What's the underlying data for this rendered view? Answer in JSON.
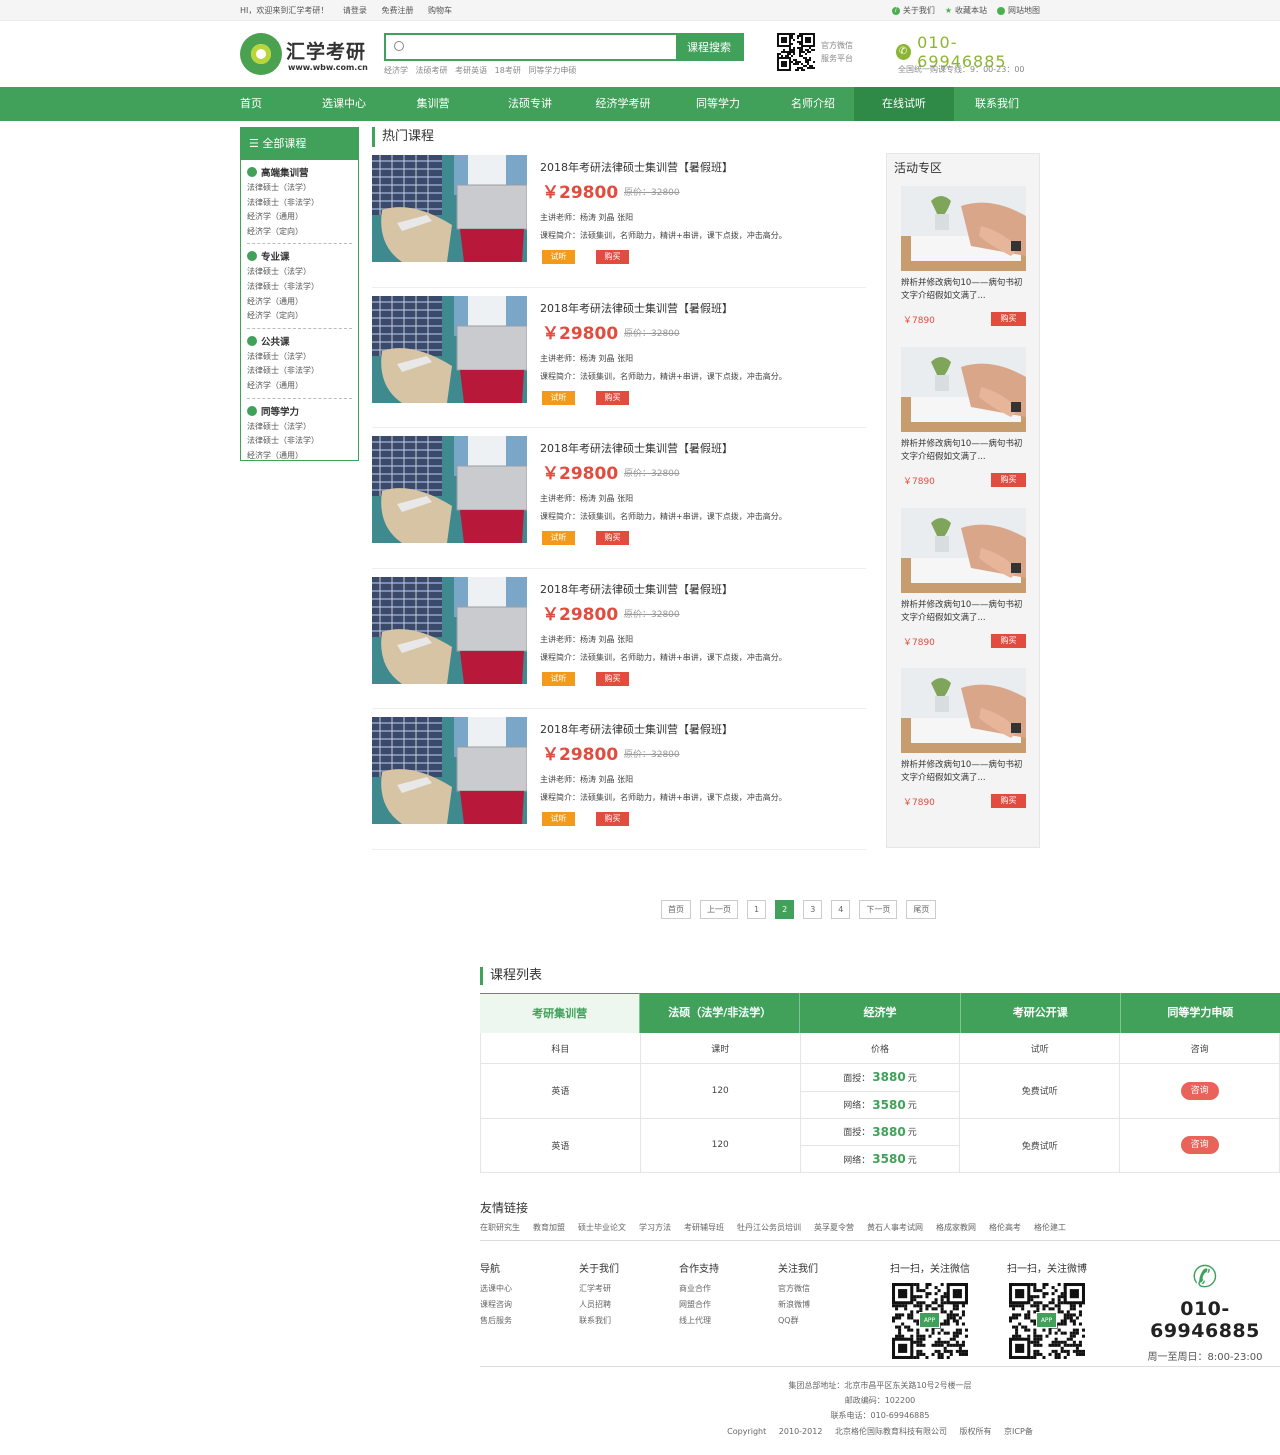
{
  "topbar": {
    "welcome": "HI，欢迎来到汇学考研！",
    "login": "请登录",
    "register": "免费注册",
    "cart": "购物车",
    "about": "关于我们",
    "favorite": "收藏本站",
    "sitemap": "网站地图"
  },
  "header": {
    "logo_title": "汇学考研",
    "logo_url": "www.wbw.com.cn",
    "search_placeholder": "",
    "search_button": "课程搜索",
    "hot_keywords": [
      "经济学",
      "法硕考研",
      "考研英语",
      "18考研",
      "同等学力申硕"
    ],
    "wechat_line1": "官方微信",
    "wechat_line2": "服务平台",
    "phone": "010-69946885",
    "phone_note": "全国统一购课专线：9：00-23：00"
  },
  "nav": {
    "items": [
      "首页",
      "选课中心",
      "集训营",
      "法硕专讲",
      "经济学考研",
      "同等学力",
      "名师介绍",
      "在线试听",
      "联系我们"
    ],
    "active_index": 7
  },
  "sidebar": {
    "title": "全部课程",
    "groups": [
      {
        "title": "高端集训营",
        "items": [
          "法律硕士（法学）",
          "法律硕士（非法学）",
          "经济学（通用）",
          "经济学（定向）"
        ]
      },
      {
        "title": "专业课",
        "items": [
          "法律硕士（法学）",
          "法律硕士（非法学）",
          "经济学（通用）",
          "经济学（定向）"
        ]
      },
      {
        "title": "公共课",
        "items": [
          "法律硕士（法学）",
          "法律硕士（非法学）",
          "经济学（通用）"
        ]
      },
      {
        "title": "同等学力",
        "items": [
          "法律硕士（法学）",
          "法律硕士（非法学）",
          "经济学（通用）"
        ]
      }
    ]
  },
  "hot": {
    "title": "热门课程",
    "courses": [
      {
        "name": "2018年考研法律硕士集训营【暑假班】",
        "price": "￥29800",
        "old_price": "原价：32800",
        "teacher": "主讲老师：杨涛  刘晶  张阳",
        "intro": "课程简介：法硕集训，名师助力，精讲+串讲，课下点拨，冲击高分。",
        "trial": "试听",
        "buy": "购买"
      },
      {
        "name": "2018年考研法律硕士集训营【暑假班】",
        "price": "￥29800",
        "old_price": "原价：32800",
        "teacher": "主讲老师：杨涛  刘晶  张阳",
        "intro": "课程简介：法硕集训，名师助力，精讲+串讲，课下点拨，冲击高分。",
        "trial": "试听",
        "buy": "购买"
      },
      {
        "name": "2018年考研法律硕士集训营【暑假班】",
        "price": "￥29800",
        "old_price": "原价：32800",
        "teacher": "主讲老师：杨涛  刘晶  张阳",
        "intro": "课程简介：法硕集训，名师助力，精讲+串讲，课下点拨，冲击高分。",
        "trial": "试听",
        "buy": "购买"
      },
      {
        "name": "2018年考研法律硕士集训营【暑假班】",
        "price": "￥29800",
        "old_price": "原价：32800",
        "teacher": "主讲老师：杨涛  刘晶  张阳",
        "intro": "课程简介：法硕集训，名师助力，精讲+串讲，课下点拨，冲击高分。",
        "trial": "试听",
        "buy": "购买"
      },
      {
        "name": "2018年考研法律硕士集训营【暑假班】",
        "price": "￥29800",
        "old_price": "原价：32800",
        "teacher": "主讲老师：杨涛  刘晶  张阳",
        "intro": "课程简介：法硕集训，名师助力，精讲+串讲，课下点拨，冲击高分。",
        "trial": "试听",
        "buy": "购买"
      }
    ]
  },
  "activity": {
    "title": "活动专区",
    "items": [
      {
        "text": "辨析并修改病句10——病句书初文字介绍假如文满了...",
        "price": "￥7890",
        "buy": "购买"
      },
      {
        "text": "辨析并修改病句10——病句书初文字介绍假如文满了...",
        "price": "￥7890",
        "buy": "购买"
      },
      {
        "text": "辨析并修改病句10——病句书初文字介绍假如文满了...",
        "price": "￥7890",
        "buy": "购买"
      },
      {
        "text": "辨析并修改病句10——病句书初文字介绍假如文满了...",
        "price": "￥7890",
        "buy": "购买"
      }
    ]
  },
  "pager": {
    "first": "首页",
    "prev": "上一页",
    "pages": [
      "1",
      "2",
      "3",
      "4"
    ],
    "current": 1,
    "next": "下一页",
    "last": "尾页"
  },
  "course_list": {
    "title": "课程列表",
    "tabs": [
      "考研集训营",
      "法硕（法学/非法学）",
      "经济学",
      "考研公开课",
      "同等学力申硕"
    ],
    "active_tab": 0,
    "headers": [
      "科目",
      "课时",
      "价格",
      "试听",
      "咨询"
    ],
    "rows": [
      {
        "subject": "英语",
        "hours": "120",
        "offline_label": "面授：",
        "offline_price": "3880",
        "online_label": "网络：",
        "online_price": "3580",
        "unit": "元",
        "trial": "免费试听",
        "consult": "咨询"
      },
      {
        "subject": "英语",
        "hours": "120",
        "offline_label": "面授：",
        "offline_price": "3880",
        "online_label": "网络：",
        "online_price": "3580",
        "unit": "元",
        "trial": "免费试听",
        "consult": "咨询"
      }
    ]
  },
  "friend_links": {
    "title": "友情链接",
    "items": [
      "在职研究生",
      "教育加盟",
      "硕士毕业论文",
      "学习方法",
      "考研辅导班",
      "牡丹江公务员培训",
      "英孚夏令营",
      "黄石人事考试网",
      "格成家教网",
      "格伦高考",
      "格伦建工"
    ]
  },
  "footer": {
    "cols": [
      {
        "title": "导航",
        "items": [
          "选课中心",
          "课程咨询",
          "售后服务"
        ]
      },
      {
        "title": "关于我们",
        "items": [
          "汇学考研",
          "人员招聘",
          "联系我们"
        ]
      },
      {
        "title": "合作支持",
        "items": [
          "商业合作",
          "网盟合作",
          "线上代理"
        ]
      },
      {
        "title": "关注我们",
        "items": [
          "官方微信",
          "新浪微博",
          "QQ群"
        ]
      }
    ],
    "qr_wechat": "扫一扫，关注微信",
    "qr_weibo": "扫一扫，关注微博",
    "qr_badge": "APP",
    "phone": "010-69946885",
    "hours": "周一至周日：8:00-23:00",
    "address": "集团总部地址：北京市昌平区东关路10号2号楼一层",
    "postcode": "邮政编码：102200",
    "tel": "联系电话：010-69946885",
    "copyright": "Copyright",
    "years": "2010-2012",
    "company": "北京格伦国际教育科技有限公司",
    "rights": "版权所有",
    "icp": "京ICP备"
  },
  "colors": {
    "brand_green": "#41a15a",
    "price_red": "#e24c3f",
    "trial_orange": "#f39a1b",
    "phone_olive": "#8cb533"
  }
}
